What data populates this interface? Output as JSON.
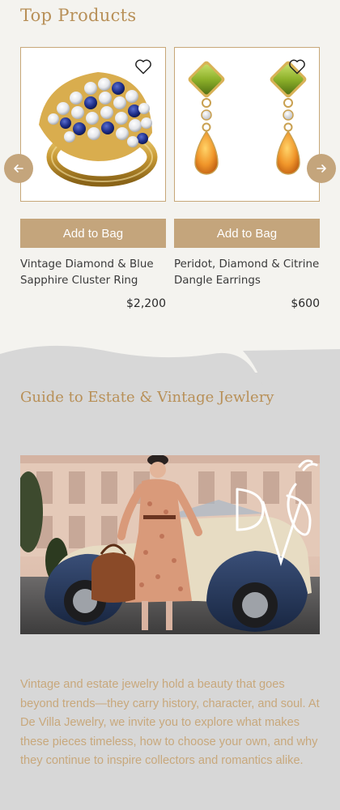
{
  "top_products": {
    "title": "Top Products",
    "products": [
      {
        "name": "Vintage Diamond & Blue Sapphire Cluster Ring",
        "price": "$2,200",
        "button_label": "Add to Bag",
        "image_icon": "sapphire-cluster-ring-image"
      },
      {
        "name": "Peridot, Diamond & Citrine Dangle Earrings",
        "price": "$600",
        "button_label": "Add to Bag",
        "image_icon": "peridot-citrine-earrings-image"
      }
    ],
    "wishlist_icon": "heart-icon",
    "prev_icon": "arrow-left-icon",
    "next_icon": "arrow-right-icon"
  },
  "guide": {
    "title": "Guide to Estate & Vintage Jewlery",
    "hero_image": "woman-vintage-car-image",
    "logo": "de-villa-logo",
    "body": "Vintage and estate jewelry hold a beauty that goes beyond trends—they carry history, character, and soul. At De Villa Jewelry, we invite you to explore what makes these pieces timeless, how to choose your own, and why they continue to inspire collectors and romantics alike."
  },
  "colors": {
    "accent": "#c4a57c",
    "title_gold": "#b89058",
    "page_bg": "#f4f3ef",
    "section_bg": "#d7d7d7"
  }
}
